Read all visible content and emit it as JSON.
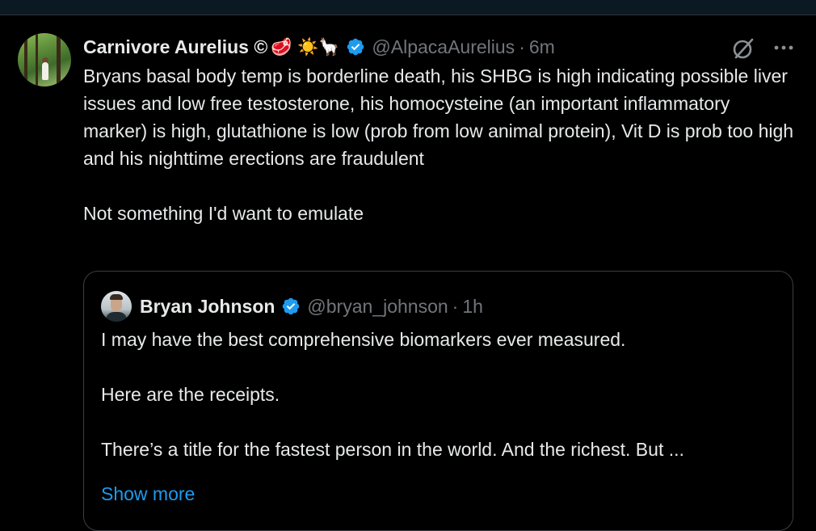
{
  "tweet": {
    "author": {
      "display_name": "Carnivore Aurelius ©",
      "emojis": "🥩 ☀️🦙",
      "verified": true,
      "handle": "@AlpacaAurelius",
      "separator": "·",
      "time": "6m"
    },
    "text": "Bryans basal body temp is borderline death, his SHBG is high indicating possible liver issues and low free testosterone, his homocysteine (an important inflammatory marker) is high, glutathione is low (prob from low animal protein), Vit D is prob too high and his nighttime erections are fraudulent\n\nNot something I'd want to emulate",
    "icons": {
      "grok": "grok-icon",
      "more": "more-icon"
    }
  },
  "quote": {
    "author": {
      "display_name": "Bryan Johnson",
      "verified": true,
      "handle": "@bryan_johnson",
      "separator": "·",
      "time": "1h"
    },
    "text": "I may have the best comprehensive biomarkers ever measured.\n\nHere are the receipts.\n\nThere’s a title for the fastest person in the world. And the richest. But ...",
    "show_more_label": "Show more"
  },
  "colors": {
    "background": "#000000",
    "text": "#e7e9ea",
    "secondary_text": "#71767b",
    "link": "#1d9bf0",
    "verified_badge": "#1d9bf0",
    "border": "#3a3f44"
  }
}
